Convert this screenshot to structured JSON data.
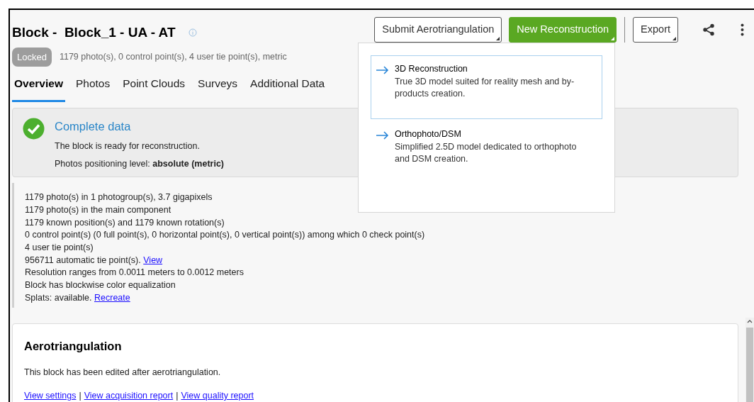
{
  "header": {
    "title": "Block -  Block_1 - UA - AT",
    "badge": "Locked",
    "summary": "1179 photo(s), 0 control point(s), 4 user tie point(s), metric"
  },
  "actions": [
    {
      "label": "Submit Aerotriangulation",
      "kind": "outline"
    },
    {
      "label": "New Reconstruction",
      "kind": "primary"
    },
    {
      "label": "Export",
      "kind": "outline"
    }
  ],
  "tabs": [
    {
      "label": "Overview",
      "selected": true
    },
    {
      "label": "Photos",
      "selected": false
    },
    {
      "label": "Point Clouds",
      "selected": false
    },
    {
      "label": "Surveys",
      "selected": false
    },
    {
      "label": "Additional Data",
      "selected": false
    }
  ],
  "menu": [
    {
      "title": "3D Reconstruction",
      "description": "True 3D model suited for reality mesh and by-products creation.",
      "selected": true
    },
    {
      "title": "Orthophoto/DSM",
      "description": "Simplified 2.5D model dedicated to orthophoto and DSM creation.",
      "selected": false
    }
  ],
  "status_card": {
    "title": "Complete data",
    "message": "The block is ready for reconstruction.",
    "positioning": "Photos positioning level: **absolute (metric)**"
  },
  "details": [
    {
      "text": "1179 photo(s) in 1 photogroup(s), 3.7 gigapixels"
    },
    {
      "text": "1179 photo(s) in the main component"
    },
    {
      "text": "1179 known position(s) and 1179 known rotation(s)"
    },
    {
      "text": "0 control point(s) (0 full point(s), 0 horizontal point(s), 0 vertical point(s)) among which 0 check point(s)"
    },
    {
      "text": "4 user tie point(s)"
    },
    {
      "text": "956711 automatic tie point(s).",
      "link": "View"
    },
    {
      "text": "Resolution ranges from 0.0011 meters to 0.0012 meters"
    },
    {
      "text": "Block has blockwise color equalization"
    },
    {
      "text": "Splats: available.",
      "link": "Recreate"
    }
  ],
  "aerotriangulation": {
    "title": "Aerotriangulation",
    "message": "This block has been edited after aerotriangulation.",
    "links": [
      "View settings",
      "View acquisition report",
      "View quality report"
    ],
    "separator": "|"
  }
}
